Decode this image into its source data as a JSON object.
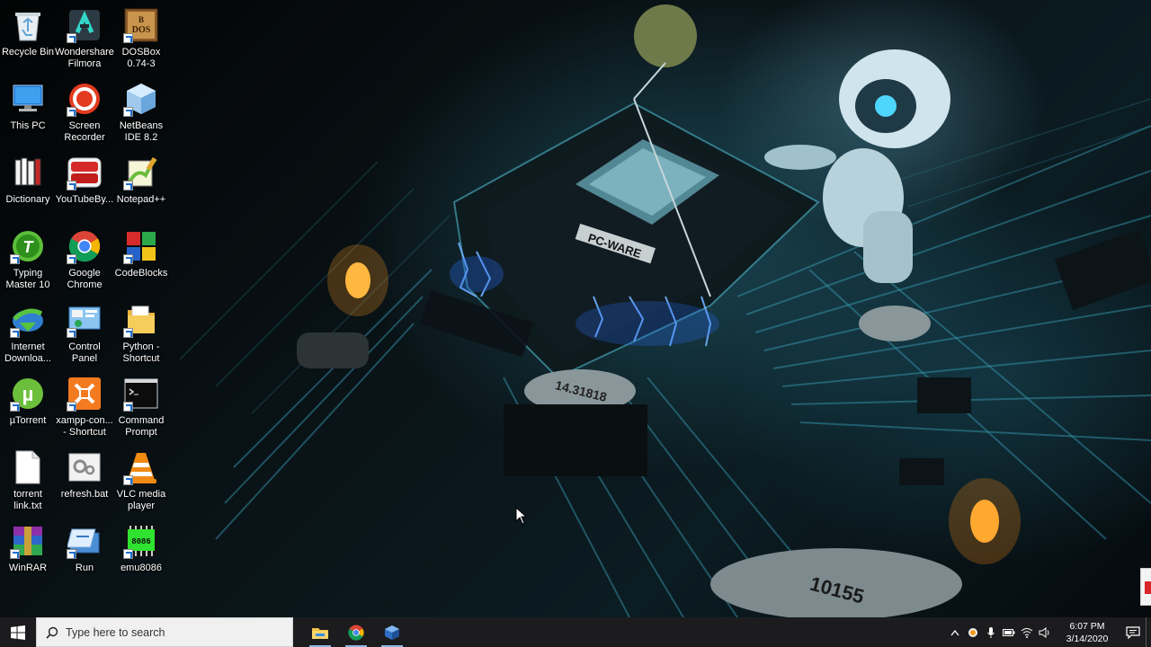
{
  "desktop": {
    "icons": [
      {
        "label": "Recycle Bin",
        "icon": "recycle-bin-icon"
      },
      {
        "label": "Wondershare Filmora",
        "icon": "filmora-icon"
      },
      {
        "label": "DOSBox 0.74-3",
        "icon": "dosbox-icon"
      },
      {
        "label": "This PC",
        "icon": "this-pc-icon"
      },
      {
        "label": "Screen Recorder",
        "icon": "screen-recorder-icon"
      },
      {
        "label": "NetBeans IDE 8.2",
        "icon": "netbeans-icon"
      },
      {
        "label": "Dictionary",
        "icon": "dictionary-icon"
      },
      {
        "label": "YouTubeBy...",
        "icon": "youtubebyclick-icon"
      },
      {
        "label": "Notepad++",
        "icon": "notepadpp-icon"
      },
      {
        "label": "Typing Master 10",
        "icon": "typing-master-icon"
      },
      {
        "label": "Google Chrome",
        "icon": "chrome-icon"
      },
      {
        "label": "CodeBlocks",
        "icon": "codeblocks-icon"
      },
      {
        "label": "Internet Downloa...",
        "icon": "idm-icon"
      },
      {
        "label": "Control Panel",
        "icon": "control-panel-icon"
      },
      {
        "label": "Python - Shortcut",
        "icon": "folder-icon"
      },
      {
        "label": "µTorrent",
        "icon": "utorrent-icon"
      },
      {
        "label": "xampp-con... - Shortcut",
        "icon": "xampp-icon"
      },
      {
        "label": "Command Prompt",
        "icon": "command-prompt-icon"
      },
      {
        "label": "torrent link.txt",
        "icon": "text-file-icon"
      },
      {
        "label": "refresh.bat",
        "icon": "batch-file-icon"
      },
      {
        "label": "VLC media player",
        "icon": "vlc-icon"
      },
      {
        "label": "WinRAR",
        "icon": "winrar-icon"
      },
      {
        "label": "Run",
        "icon": "run-icon"
      },
      {
        "label": "emu8086",
        "icon": "emu8086-icon"
      }
    ],
    "emu8086_badge": "8086",
    "dosbox_letters": "DOS",
    "wallpaper_chip_text": "PC-WARE",
    "wallpaper_crystal_text": "14.31818",
    "wallpaper_bottom_text": "10155"
  },
  "taskbar": {
    "search_placeholder": "Type here to search",
    "pinned": [
      {
        "name": "file-explorer",
        "icon": "file-explorer-icon"
      },
      {
        "name": "google-chrome",
        "icon": "chrome-icon"
      },
      {
        "name": "virtualbox",
        "icon": "virtualbox-icon"
      }
    ],
    "tray": {
      "time": "6:07 PM",
      "date": "3/14/2020"
    }
  },
  "colors": {
    "taskbar_bg": "#1c1c1f",
    "search_bg": "#f0f0f0",
    "accent": "#8fb3e0"
  }
}
